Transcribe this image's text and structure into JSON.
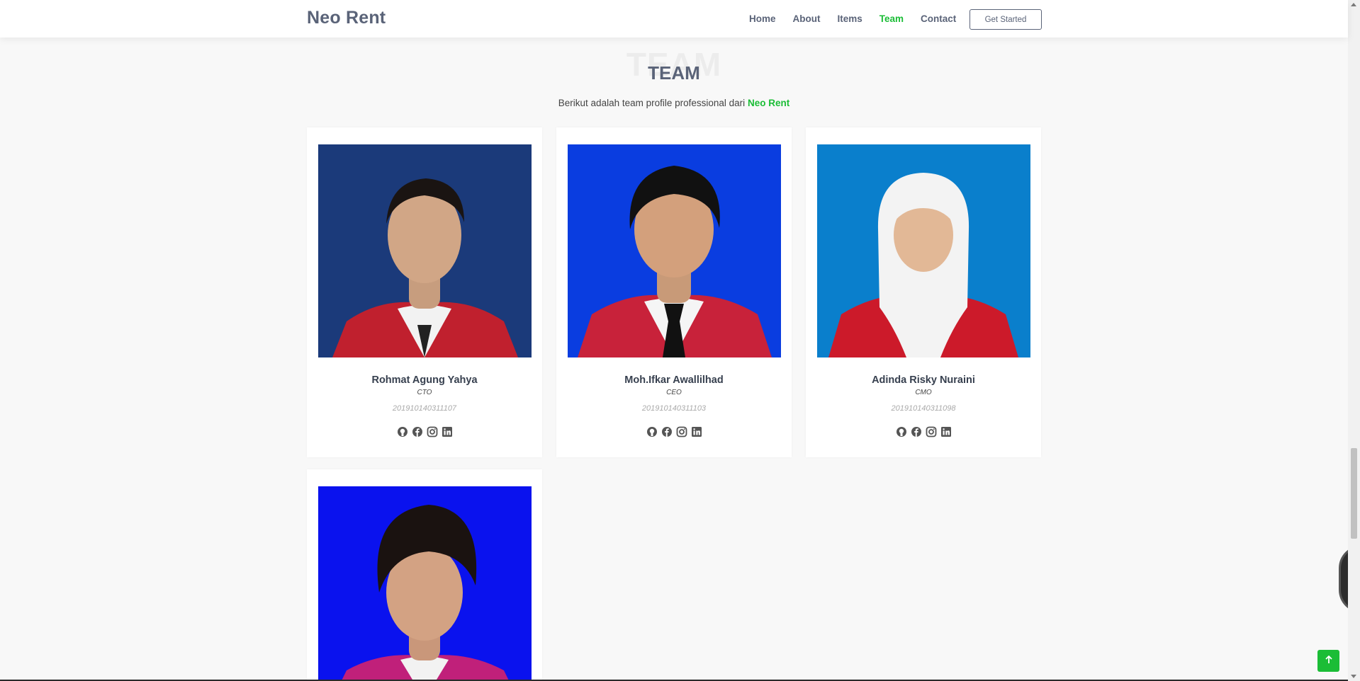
{
  "brand": "Neo Rent",
  "nav": {
    "items": [
      {
        "label": "Home",
        "active": false
      },
      {
        "label": "About",
        "active": false
      },
      {
        "label": "Items",
        "active": false
      },
      {
        "label": "Team",
        "active": true
      },
      {
        "label": "Contact",
        "active": false
      }
    ],
    "cta": "Get Started"
  },
  "section": {
    "bg_title": "TEAM",
    "title": "TEAM",
    "subtitle_prefix": "Berikut adalah team profile professional dari",
    "subtitle_brand": "Neo Rent"
  },
  "team": [
    {
      "name": "Rohmat Agung Yahya",
      "role": "CTO",
      "nim": "201910140311107",
      "photo_bg": "#1b3a7a",
      "jacket": "#c0202e"
    },
    {
      "name": "Moh.Ifkar Awallilhad",
      "role": "CEO",
      "nim": "201910140311103",
      "photo_bg": "#0a3de0",
      "jacket": "#c8223a"
    },
    {
      "name": "Adinda Risky Nuraini",
      "role": "CMO",
      "nim": "201910140311098",
      "photo_bg": "#0a7fcc",
      "jacket": "#cc1a2a"
    },
    {
      "name": "",
      "role": "",
      "nim": "",
      "photo_bg": "#0a12ee",
      "jacket": "#c0207a"
    }
  ],
  "socials": [
    "github-icon",
    "facebook-icon",
    "instagram-icon",
    "linkedin-icon"
  ],
  "colors": {
    "accent": "#1bbd36",
    "heading": "#5a6378"
  }
}
